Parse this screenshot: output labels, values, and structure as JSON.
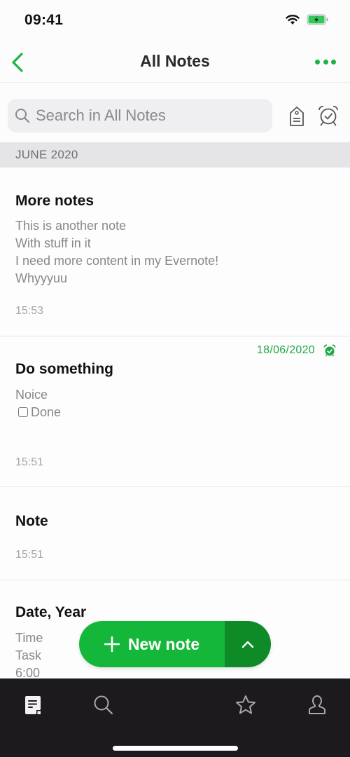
{
  "status_bar": {
    "time": "09:41",
    "wifi_icon": "wifi-icon",
    "battery_icon": "battery-charging-icon"
  },
  "nav": {
    "back_icon": "chevron-left-icon",
    "title": "All Notes",
    "more_icon": "ellipsis-icon"
  },
  "search": {
    "placeholder": "Search in All Notes",
    "value": "",
    "tag_icon": "tag-icon",
    "reminder_icon": "alarm-clock-icon"
  },
  "section": {
    "label": "JUNE 2020"
  },
  "notes": [
    {
      "title": "More notes",
      "body": [
        "This is another note",
        "With stuff in it",
        "I need more content in my Evernote!",
        "Whyyyuu"
      ],
      "time": "15:53"
    },
    {
      "title": "Do something",
      "reminder_date": "18/06/2020",
      "body_line": "Noice",
      "checklist_item": {
        "label": "Done",
        "checked": false
      },
      "time": "15:51"
    },
    {
      "title": "Note",
      "time": "15:51"
    },
    {
      "title": "Date, Year",
      "body": [
        "Time",
        "Task",
        "6:00"
      ]
    }
  ],
  "fab": {
    "label": "New note",
    "plus_icon": "plus-icon",
    "expand_icon": "chevron-up-icon"
  },
  "tab_bar": {
    "tabs": [
      {
        "name": "notes",
        "icon": "note-icon",
        "active": true
      },
      {
        "name": "search",
        "icon": "search-icon",
        "active": false
      },
      {
        "name": "shortcuts",
        "icon": "star-icon",
        "active": false
      },
      {
        "name": "account",
        "icon": "user-icon",
        "active": false
      }
    ]
  },
  "colors": {
    "accent": "#1db343",
    "fab_main": "#14b73a",
    "fab_expand": "#0e8b26",
    "tab_bar_bg": "#1c1a1c",
    "section_bg": "#e5e5e7"
  }
}
